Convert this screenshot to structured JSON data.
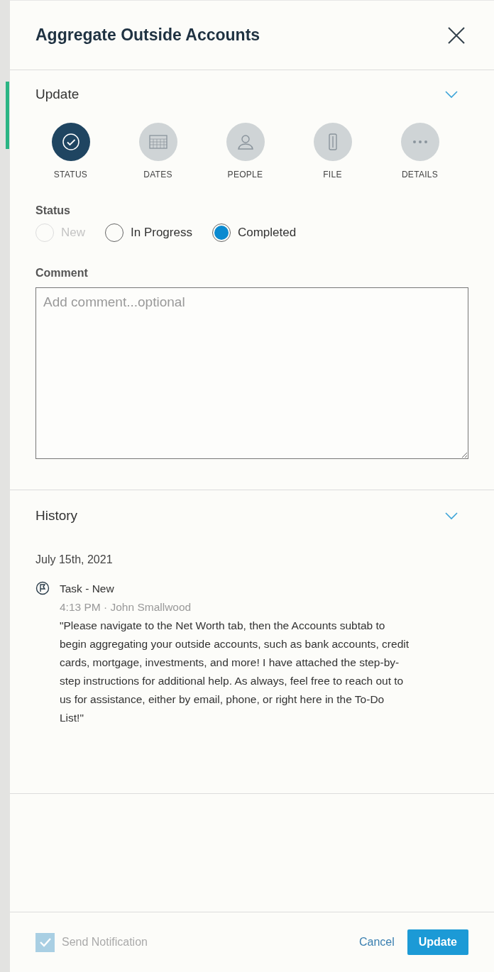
{
  "title": "Aggregate Outside Accounts",
  "update": {
    "heading": "Update",
    "expanded": true,
    "steps": [
      {
        "kind": "check",
        "label": "STATUS",
        "selected": true
      },
      {
        "kind": "calendar",
        "label": "DATES",
        "selected": false
      },
      {
        "kind": "person",
        "label": "PEOPLE",
        "selected": false
      },
      {
        "kind": "file",
        "label": "FILE",
        "selected": false
      },
      {
        "kind": "dots",
        "label": "DETAILS",
        "selected": false
      }
    ],
    "status_label": "Status",
    "status_options": [
      {
        "label": "New",
        "selected": false,
        "disabled": true
      },
      {
        "label": "In Progress",
        "selected": false,
        "disabled": false
      },
      {
        "label": "Completed",
        "selected": true,
        "disabled": false
      }
    ],
    "comment_label": "Comment",
    "comment_placeholder": "Add comment...optional"
  },
  "history": {
    "heading": "History",
    "expanded": true,
    "date": "July 15th, 2021",
    "entries": [
      {
        "title": "Task - New",
        "meta": "4:13 PM · John Smallwood",
        "text": "\"Please navigate to the Net Worth tab, then the Accounts subtab to begin aggregating your outside accounts, such as bank accounts, credit cards, mortgage, investments, and more! I have attached the step-by-step instructions for additional help. As always, feel free to reach out to us for assistance, either by email, phone, or right here in the To-Do List!\""
      }
    ]
  },
  "footer": {
    "notification": {
      "label": "Send Notification",
      "checked": true,
      "disabled": true
    },
    "cancel": "Cancel",
    "submit": "Update"
  }
}
